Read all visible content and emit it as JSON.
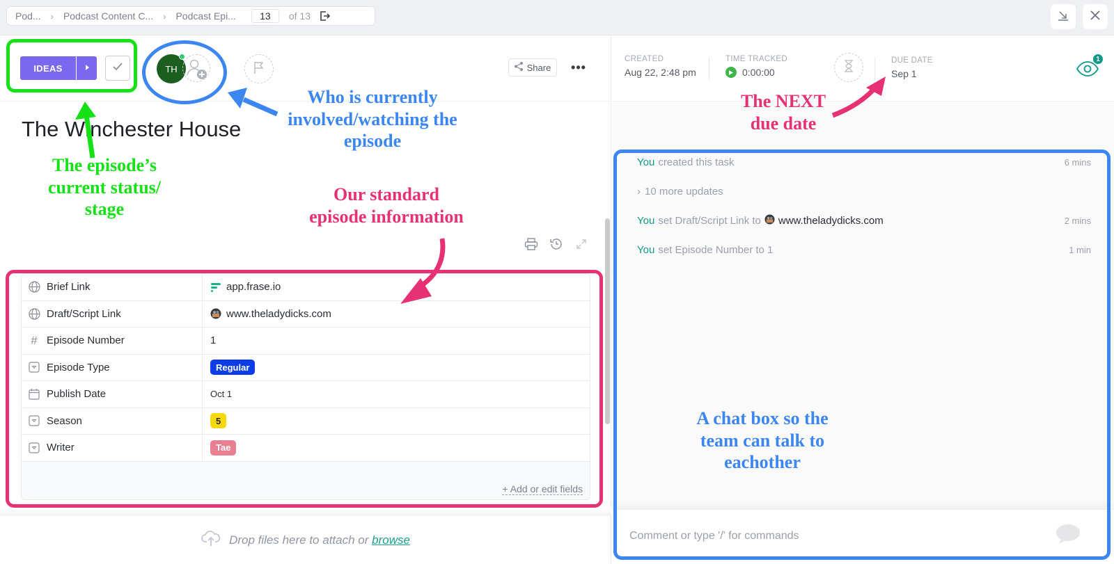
{
  "topbar": {
    "breadcrumbs": [
      "Pod...",
      "Podcast Content C...",
      "Podcast Epi..."
    ],
    "page_current": "13",
    "page_total_label": "of 13",
    "icons": {
      "exit": "exit-icon",
      "minimize": "minimize-to-tray-icon",
      "close": "close-icon"
    }
  },
  "task": {
    "status_label": "IDEAS",
    "status_color": "#7b68ee",
    "assignee_initials": "TH",
    "assignee_color": "#1b5e20",
    "title": "The Winchester House",
    "share_label": "Share"
  },
  "fields": {
    "rows": [
      {
        "icon": "globe-icon",
        "name": "Brief Link",
        "value": "app.frase.io",
        "value_type": "link",
        "favicon": "frase-favicon"
      },
      {
        "icon": "globe-icon",
        "name": "Draft/Script Link",
        "value": "www.theladydicks.com",
        "value_type": "link",
        "favicon": "site-favicon"
      },
      {
        "icon": "hash-icon",
        "name": "Episode Number",
        "value": "1",
        "value_type": "number"
      },
      {
        "icon": "dropdown-icon",
        "name": "Episode Type",
        "value": "Regular",
        "value_type": "pill",
        "pill_bg": "#0a3ce8",
        "pill_fg": "#ffffff"
      },
      {
        "icon": "calendar-icon",
        "name": "Publish Date",
        "value": "Oct 1",
        "value_type": "date"
      },
      {
        "icon": "dropdown-icon",
        "name": "Season",
        "value": "5",
        "value_type": "pill",
        "pill_bg": "#f5d90a",
        "pill_fg": "#292d34"
      },
      {
        "icon": "dropdown-icon",
        "name": "Writer",
        "value": "Tae",
        "value_type": "pill",
        "pill_bg": "#e97f92",
        "pill_fg": "#ffffff"
      }
    ],
    "add_label": "+ Add or edit fields"
  },
  "attachments": {
    "drop_text": "Drop files here to attach or",
    "browse_label": "browse"
  },
  "meta": {
    "created_label": "CREATED",
    "created_value": "Aug 22, 2:48 pm",
    "time_tracked_label": "TIME TRACKED",
    "time_tracked_value": "0:00:00",
    "due_date_label": "DUE DATE",
    "due_date_value": "Sep 1",
    "watchers_count": "1"
  },
  "activity": {
    "items": [
      {
        "actor": "You",
        "text": "created this task",
        "time": "6 mins"
      },
      {
        "actor": "",
        "text": "10 more updates",
        "time": "",
        "collapsed": true
      },
      {
        "actor": "You",
        "text": "set Draft/Script Link to",
        "target": "www.theladydicks.com",
        "time": "2 mins"
      },
      {
        "actor": "You",
        "text": "set Episode Number to 1",
        "time": "1 min"
      }
    ],
    "comment_placeholder": "Comment or type '/' for commands"
  },
  "annotations": {
    "status": [
      "The episode’s",
      "current status/",
      "stage"
    ],
    "watchers": [
      "Who is currently",
      "involved/watching the",
      "episode"
    ],
    "fields": [
      "Our standard",
      "episode information"
    ],
    "due": [
      "The NEXT",
      "due date"
    ],
    "chat": [
      "A chat box so the",
      "team can talk to",
      "eachother"
    ],
    "colors": {
      "green": "#16e016",
      "blue": "#3b86f0",
      "pink": "#e63274"
    }
  }
}
